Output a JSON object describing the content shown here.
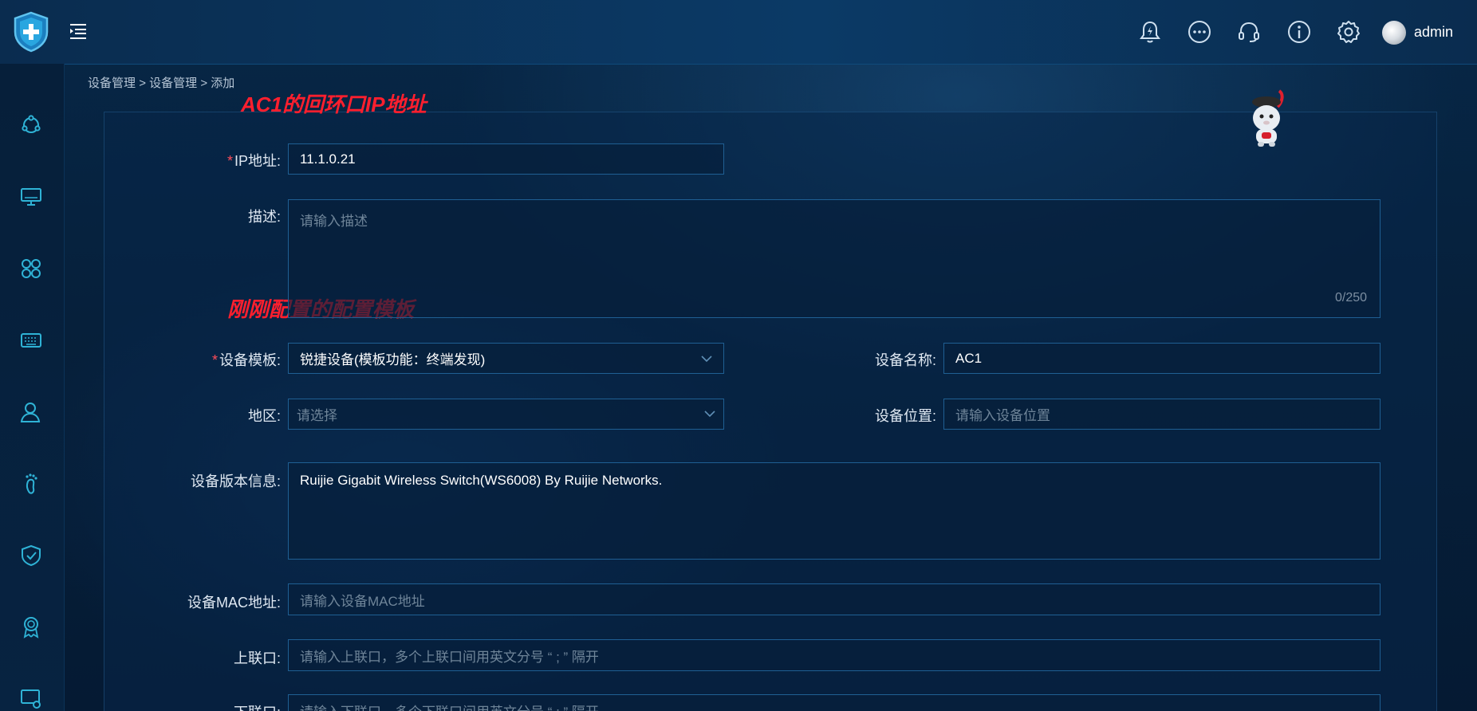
{
  "header": {
    "username": "admin",
    "icons": [
      "bell-lightning-icon",
      "more-dots-icon",
      "headset-icon",
      "info-icon",
      "gear-icon"
    ]
  },
  "sidebar": {
    "icons": [
      "topology-icon",
      "monitor-icon",
      "apps-grid-icon",
      "keyboard-icon",
      "user-icon",
      "footprint-icon",
      "shield-check-icon",
      "award-icon",
      "screen-settings-icon"
    ]
  },
  "breadcrumb": {
    "level1": "设备管理",
    "level2": "设备管理",
    "level3": "添加",
    "separator": ">"
  },
  "annotations": {
    "loopback": "AC1的回环口IP地址",
    "template": "刚刚配置的配置模板"
  },
  "form": {
    "ip": {
      "label": "IP地址:",
      "value": "11.1.0.21",
      "required_mark": "*"
    },
    "description": {
      "label": "描述:",
      "placeholder": "请输入描述",
      "counter": "0/250"
    },
    "template": {
      "label": "设备模板:",
      "value": "锐捷设备(模板功能：终端发现)",
      "required_mark": "*"
    },
    "device_name": {
      "label": "设备名称:",
      "value": "AC1"
    },
    "region": {
      "label": "地区:",
      "placeholder": "请选择"
    },
    "location": {
      "label": "设备位置:",
      "placeholder": "请输入设备位置"
    },
    "version": {
      "label": "设备版本信息:",
      "value": "Ruijie Gigabit Wireless Switch(WS6008) By Ruijie Networks."
    },
    "mac": {
      "label": "设备MAC地址:",
      "placeholder": "请输入设备MAC地址"
    },
    "uplink": {
      "label": "上联口:",
      "placeholder": "请输入上联口，多个上联口间用英文分号 “ ; ” 隔开"
    },
    "downlink": {
      "label": "下联口:",
      "placeholder": "请输入下联口，多个下联口间用英文分号 “ ; ” 隔开"
    }
  },
  "colors": {
    "accent": "#2fb3d6",
    "required": "#ff4d5a",
    "annotation": "#ff1f2e",
    "border": "#1f5f93"
  }
}
